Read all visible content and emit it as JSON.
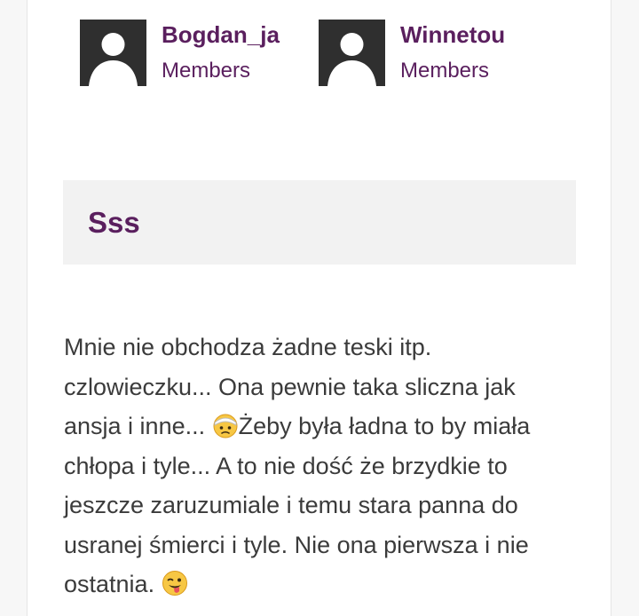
{
  "members": [
    {
      "username": "Bogdan_ja",
      "role": "Members",
      "avatar": "default-avatar-icon"
    },
    {
      "username": "Winnetou",
      "role": "Members",
      "avatar": "default-avatar-icon"
    }
  ],
  "post": {
    "title": "Sss",
    "lines": [
      "Mnie nie obchodza żadne teski itp.",
      "czlowieczku... Ona pewnie taka sliczna jak",
      "ansja i inne... ",
      "Żeby była ładna to by miała",
      "chłopa i tyle... A to nie dość że brzydkie to",
      "jeszcze zaruzumiale i temu stara panna do",
      "usranej śmierci i tyle. Nie ona pierwsza i nie",
      "ostatnia. "
    ],
    "emoji_1": "face-with-head-bandage-emoji",
    "emoji_2": "winking-face-with-tongue-emoji"
  },
  "colors": {
    "accent": "#5a1f5e",
    "text": "#3b3b3b",
    "title_box": "#f2f2f2",
    "avatar_bg": "#2f2f2f"
  }
}
